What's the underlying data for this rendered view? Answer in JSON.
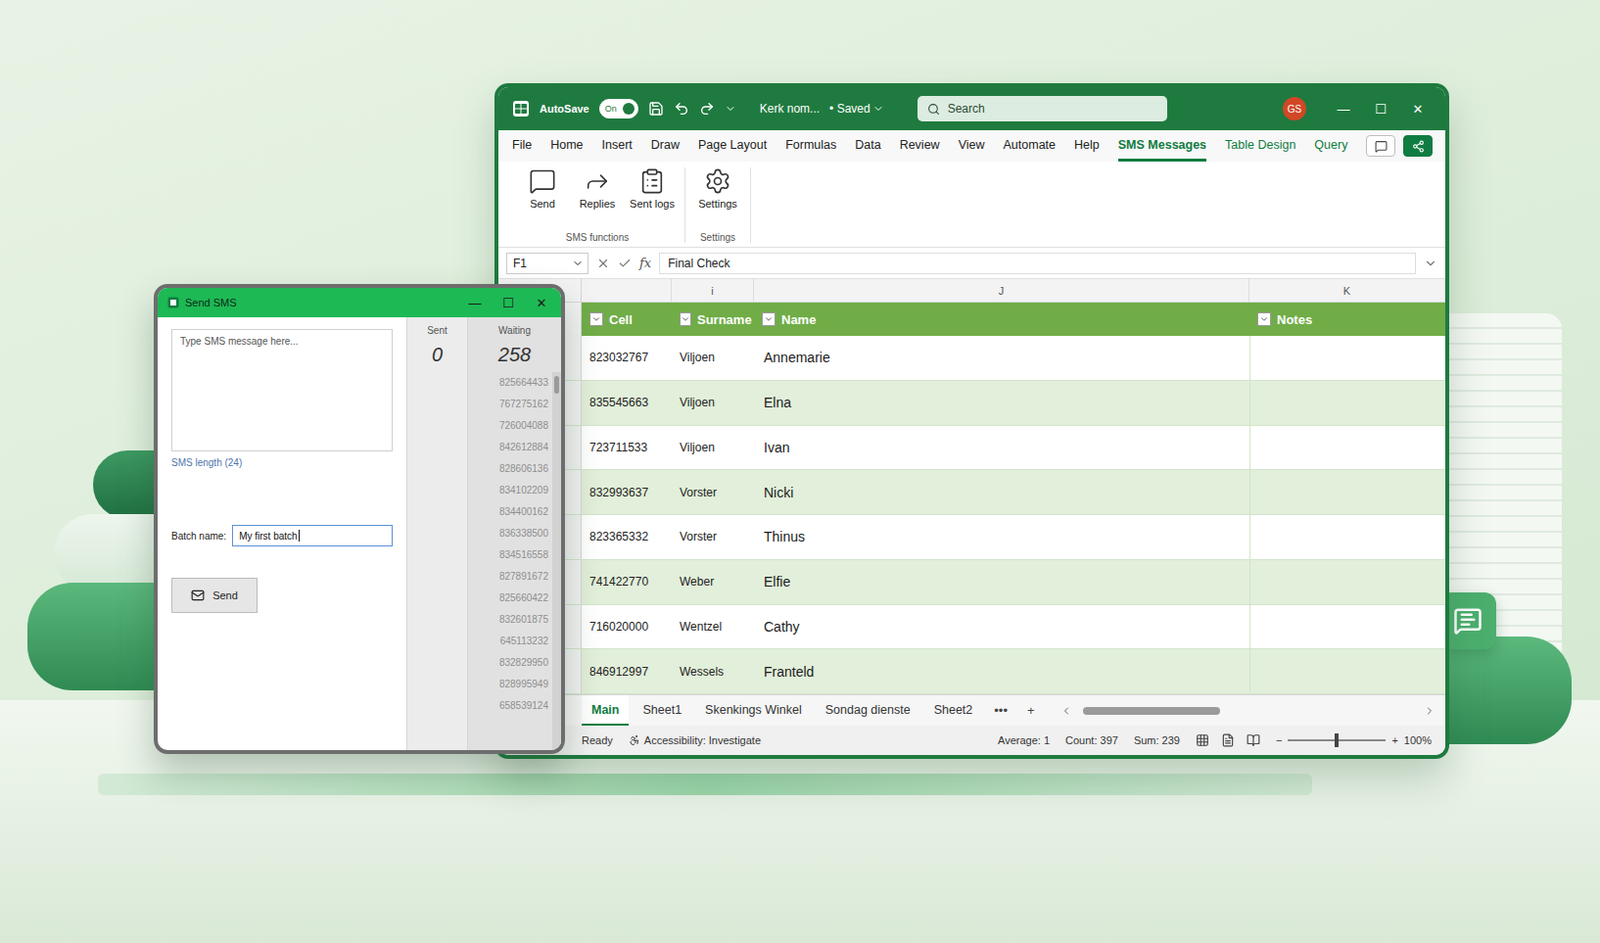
{
  "excel": {
    "autosave": {
      "label": "AutoSave",
      "on": true,
      "state_text": "On"
    },
    "file_name": "Kerk nom...",
    "saved": "• Saved",
    "search": {
      "placeholder": "Search"
    },
    "avatar": "GS",
    "window_buttons": [
      "—",
      "☐",
      "✕"
    ],
    "menu": [
      {
        "label": "File",
        "selected": false,
        "kind": "normal"
      },
      {
        "label": "Home",
        "selected": false,
        "kind": "normal"
      },
      {
        "label": "Insert",
        "selected": false,
        "kind": "normal"
      },
      {
        "label": "Draw",
        "selected": false,
        "kind": "normal"
      },
      {
        "label": "Page Layout",
        "selected": false,
        "kind": "normal"
      },
      {
        "label": "Formulas",
        "selected": false,
        "kind": "normal"
      },
      {
        "label": "Data",
        "selected": false,
        "kind": "normal"
      },
      {
        "label": "Review",
        "selected": false,
        "kind": "normal"
      },
      {
        "label": "View",
        "selected": false,
        "kind": "normal"
      },
      {
        "label": "Automate",
        "selected": false,
        "kind": "normal"
      },
      {
        "label": "Help",
        "selected": false,
        "kind": "normal"
      },
      {
        "label": "SMS Messages",
        "selected": true,
        "kind": "normal"
      },
      {
        "label": "Table Design",
        "selected": false,
        "kind": "contextual"
      },
      {
        "label": "Query",
        "selected": false,
        "kind": "contextual"
      }
    ],
    "ribbon": {
      "groups": [
        {
          "label": "SMS functions",
          "buttons": [
            "Send",
            "Replies",
            "Sent logs"
          ]
        },
        {
          "label": "Settings",
          "buttons": [
            "Settings"
          ]
        }
      ]
    },
    "name_box": "F1",
    "fx": "fx",
    "formula": "Final Check",
    "column_letters": [
      "i",
      "J",
      "K"
    ],
    "table": {
      "columns": [
        "Cell",
        "Surname",
        "Name",
        "Notes"
      ],
      "rows": [
        {
          "cell": "823032767",
          "surname": "Viljoen",
          "name": "Annemarie"
        },
        {
          "cell": "835545663",
          "surname": "Viljoen",
          "name": "Elna"
        },
        {
          "cell": "723711533",
          "surname": "Viljoen",
          "name": "Ivan"
        },
        {
          "cell": "832993637",
          "surname": "Vorster",
          "name": "Nicki"
        },
        {
          "cell": "823365332",
          "surname": "Vorster",
          "name": "Thinus"
        },
        {
          "cell": "741422770",
          "surname": "Weber",
          "name": "Elfie"
        },
        {
          "cell": "716020000",
          "surname": "Wentzel",
          "name": "Cathy"
        },
        {
          "cell": "846912997",
          "surname": "Wessels",
          "name": "Franteld"
        }
      ]
    },
    "sheets": [
      {
        "label": "Main",
        "selected": true
      },
      {
        "label": "Sheet1",
        "selected": false
      },
      {
        "label": "Skenkings Winkel",
        "selected": false
      },
      {
        "label": "Sondag dienste",
        "selected": false
      },
      {
        "label": "Sheet2",
        "selected": false
      }
    ],
    "more_sheets": "•••",
    "add_sheet": "+",
    "h_scroll": {
      "level": 0.4
    },
    "status": {
      "ready": "Ready",
      "accessibility": "Accessibility: Investigate",
      "average": "Average: 1",
      "count": "Count: 397",
      "sum": "Sum: 239",
      "minus": "−",
      "plus": "+",
      "zoom": "100%",
      "zoom_level": 0.5
    }
  },
  "sms_dialog": {
    "title": "Send SMS",
    "window_buttons": [
      "—",
      "☐",
      "✕"
    ],
    "message_placeholder": "Type SMS message here...",
    "sms_length": "SMS length (24)",
    "batch_label": "Batch name:",
    "batch_value": "My first batch",
    "send_button": "Send",
    "sent": {
      "label": "Sent",
      "value": "0"
    },
    "waiting": {
      "label": "Waiting",
      "value": "258",
      "numbers": [
        "825664433",
        "767275162",
        "726004088",
        "842612884",
        "828606136",
        "834102209",
        "834400162",
        "836338500",
        "834516558",
        "827891672",
        "825660422",
        "832601875",
        "645113232",
        "832829950",
        "828995949",
        "658539124"
      ]
    }
  }
}
